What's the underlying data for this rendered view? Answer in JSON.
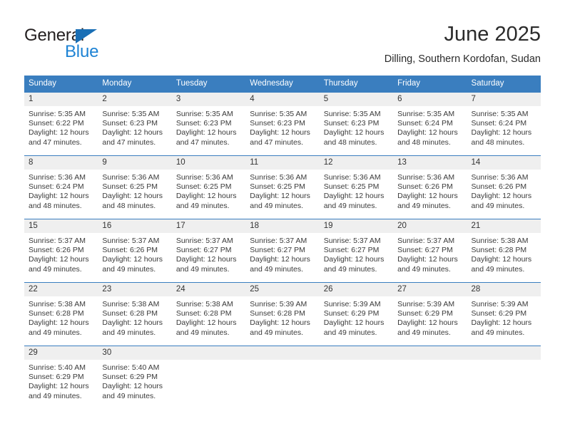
{
  "brand": {
    "name_part1": "General",
    "name_part2": "Blue",
    "triangle_icon": "triangle-icon",
    "color_dark": "#231f20",
    "color_blue": "#1e83d4"
  },
  "header": {
    "title": "June 2025",
    "subtitle": "Dilling, Southern Kordofan, Sudan"
  },
  "theme": {
    "header_blue": "#3a7ebf",
    "daynum_gray": "#efefef",
    "text": "#3a3a3a"
  },
  "calendar": {
    "weekday_headers": [
      "Sunday",
      "Monday",
      "Tuesday",
      "Wednesday",
      "Thursday",
      "Friday",
      "Saturday"
    ],
    "weeks": [
      [
        {
          "day": "1",
          "sunrise": "Sunrise: 5:35 AM",
          "sunset": "Sunset: 6:22 PM",
          "daylight_line1": "Daylight: 12 hours",
          "daylight_line2": "and 47 minutes."
        },
        {
          "day": "2",
          "sunrise": "Sunrise: 5:35 AM",
          "sunset": "Sunset: 6:23 PM",
          "daylight_line1": "Daylight: 12 hours",
          "daylight_line2": "and 47 minutes."
        },
        {
          "day": "3",
          "sunrise": "Sunrise: 5:35 AM",
          "sunset": "Sunset: 6:23 PM",
          "daylight_line1": "Daylight: 12 hours",
          "daylight_line2": "and 47 minutes."
        },
        {
          "day": "4",
          "sunrise": "Sunrise: 5:35 AM",
          "sunset": "Sunset: 6:23 PM",
          "daylight_line1": "Daylight: 12 hours",
          "daylight_line2": "and 47 minutes."
        },
        {
          "day": "5",
          "sunrise": "Sunrise: 5:35 AM",
          "sunset": "Sunset: 6:23 PM",
          "daylight_line1": "Daylight: 12 hours",
          "daylight_line2": "and 48 minutes."
        },
        {
          "day": "6",
          "sunrise": "Sunrise: 5:35 AM",
          "sunset": "Sunset: 6:24 PM",
          "daylight_line1": "Daylight: 12 hours",
          "daylight_line2": "and 48 minutes."
        },
        {
          "day": "7",
          "sunrise": "Sunrise: 5:35 AM",
          "sunset": "Sunset: 6:24 PM",
          "daylight_line1": "Daylight: 12 hours",
          "daylight_line2": "and 48 minutes."
        }
      ],
      [
        {
          "day": "8",
          "sunrise": "Sunrise: 5:36 AM",
          "sunset": "Sunset: 6:24 PM",
          "daylight_line1": "Daylight: 12 hours",
          "daylight_line2": "and 48 minutes."
        },
        {
          "day": "9",
          "sunrise": "Sunrise: 5:36 AM",
          "sunset": "Sunset: 6:25 PM",
          "daylight_line1": "Daylight: 12 hours",
          "daylight_line2": "and 48 minutes."
        },
        {
          "day": "10",
          "sunrise": "Sunrise: 5:36 AM",
          "sunset": "Sunset: 6:25 PM",
          "daylight_line1": "Daylight: 12 hours",
          "daylight_line2": "and 49 minutes."
        },
        {
          "day": "11",
          "sunrise": "Sunrise: 5:36 AM",
          "sunset": "Sunset: 6:25 PM",
          "daylight_line1": "Daylight: 12 hours",
          "daylight_line2": "and 49 minutes."
        },
        {
          "day": "12",
          "sunrise": "Sunrise: 5:36 AM",
          "sunset": "Sunset: 6:25 PM",
          "daylight_line1": "Daylight: 12 hours",
          "daylight_line2": "and 49 minutes."
        },
        {
          "day": "13",
          "sunrise": "Sunrise: 5:36 AM",
          "sunset": "Sunset: 6:26 PM",
          "daylight_line1": "Daylight: 12 hours",
          "daylight_line2": "and 49 minutes."
        },
        {
          "day": "14",
          "sunrise": "Sunrise: 5:36 AM",
          "sunset": "Sunset: 6:26 PM",
          "daylight_line1": "Daylight: 12 hours",
          "daylight_line2": "and 49 minutes."
        }
      ],
      [
        {
          "day": "15",
          "sunrise": "Sunrise: 5:37 AM",
          "sunset": "Sunset: 6:26 PM",
          "daylight_line1": "Daylight: 12 hours",
          "daylight_line2": "and 49 minutes."
        },
        {
          "day": "16",
          "sunrise": "Sunrise: 5:37 AM",
          "sunset": "Sunset: 6:26 PM",
          "daylight_line1": "Daylight: 12 hours",
          "daylight_line2": "and 49 minutes."
        },
        {
          "day": "17",
          "sunrise": "Sunrise: 5:37 AM",
          "sunset": "Sunset: 6:27 PM",
          "daylight_line1": "Daylight: 12 hours",
          "daylight_line2": "and 49 minutes."
        },
        {
          "day": "18",
          "sunrise": "Sunrise: 5:37 AM",
          "sunset": "Sunset: 6:27 PM",
          "daylight_line1": "Daylight: 12 hours",
          "daylight_line2": "and 49 minutes."
        },
        {
          "day": "19",
          "sunrise": "Sunrise: 5:37 AM",
          "sunset": "Sunset: 6:27 PM",
          "daylight_line1": "Daylight: 12 hours",
          "daylight_line2": "and 49 minutes."
        },
        {
          "day": "20",
          "sunrise": "Sunrise: 5:37 AM",
          "sunset": "Sunset: 6:27 PM",
          "daylight_line1": "Daylight: 12 hours",
          "daylight_line2": "and 49 minutes."
        },
        {
          "day": "21",
          "sunrise": "Sunrise: 5:38 AM",
          "sunset": "Sunset: 6:28 PM",
          "daylight_line1": "Daylight: 12 hours",
          "daylight_line2": "and 49 minutes."
        }
      ],
      [
        {
          "day": "22",
          "sunrise": "Sunrise: 5:38 AM",
          "sunset": "Sunset: 6:28 PM",
          "daylight_line1": "Daylight: 12 hours",
          "daylight_line2": "and 49 minutes."
        },
        {
          "day": "23",
          "sunrise": "Sunrise: 5:38 AM",
          "sunset": "Sunset: 6:28 PM",
          "daylight_line1": "Daylight: 12 hours",
          "daylight_line2": "and 49 minutes."
        },
        {
          "day": "24",
          "sunrise": "Sunrise: 5:38 AM",
          "sunset": "Sunset: 6:28 PM",
          "daylight_line1": "Daylight: 12 hours",
          "daylight_line2": "and 49 minutes."
        },
        {
          "day": "25",
          "sunrise": "Sunrise: 5:39 AM",
          "sunset": "Sunset: 6:28 PM",
          "daylight_line1": "Daylight: 12 hours",
          "daylight_line2": "and 49 minutes."
        },
        {
          "day": "26",
          "sunrise": "Sunrise: 5:39 AM",
          "sunset": "Sunset: 6:29 PM",
          "daylight_line1": "Daylight: 12 hours",
          "daylight_line2": "and 49 minutes."
        },
        {
          "day": "27",
          "sunrise": "Sunrise: 5:39 AM",
          "sunset": "Sunset: 6:29 PM",
          "daylight_line1": "Daylight: 12 hours",
          "daylight_line2": "and 49 minutes."
        },
        {
          "day": "28",
          "sunrise": "Sunrise: 5:39 AM",
          "sunset": "Sunset: 6:29 PM",
          "daylight_line1": "Daylight: 12 hours",
          "daylight_line2": "and 49 minutes."
        }
      ],
      [
        {
          "day": "29",
          "sunrise": "Sunrise: 5:40 AM",
          "sunset": "Sunset: 6:29 PM",
          "daylight_line1": "Daylight: 12 hours",
          "daylight_line2": "and 49 minutes."
        },
        {
          "day": "30",
          "sunrise": "Sunrise: 5:40 AM",
          "sunset": "Sunset: 6:29 PM",
          "daylight_line1": "Daylight: 12 hours",
          "daylight_line2": "and 49 minutes."
        },
        null,
        null,
        null,
        null,
        null
      ]
    ]
  }
}
